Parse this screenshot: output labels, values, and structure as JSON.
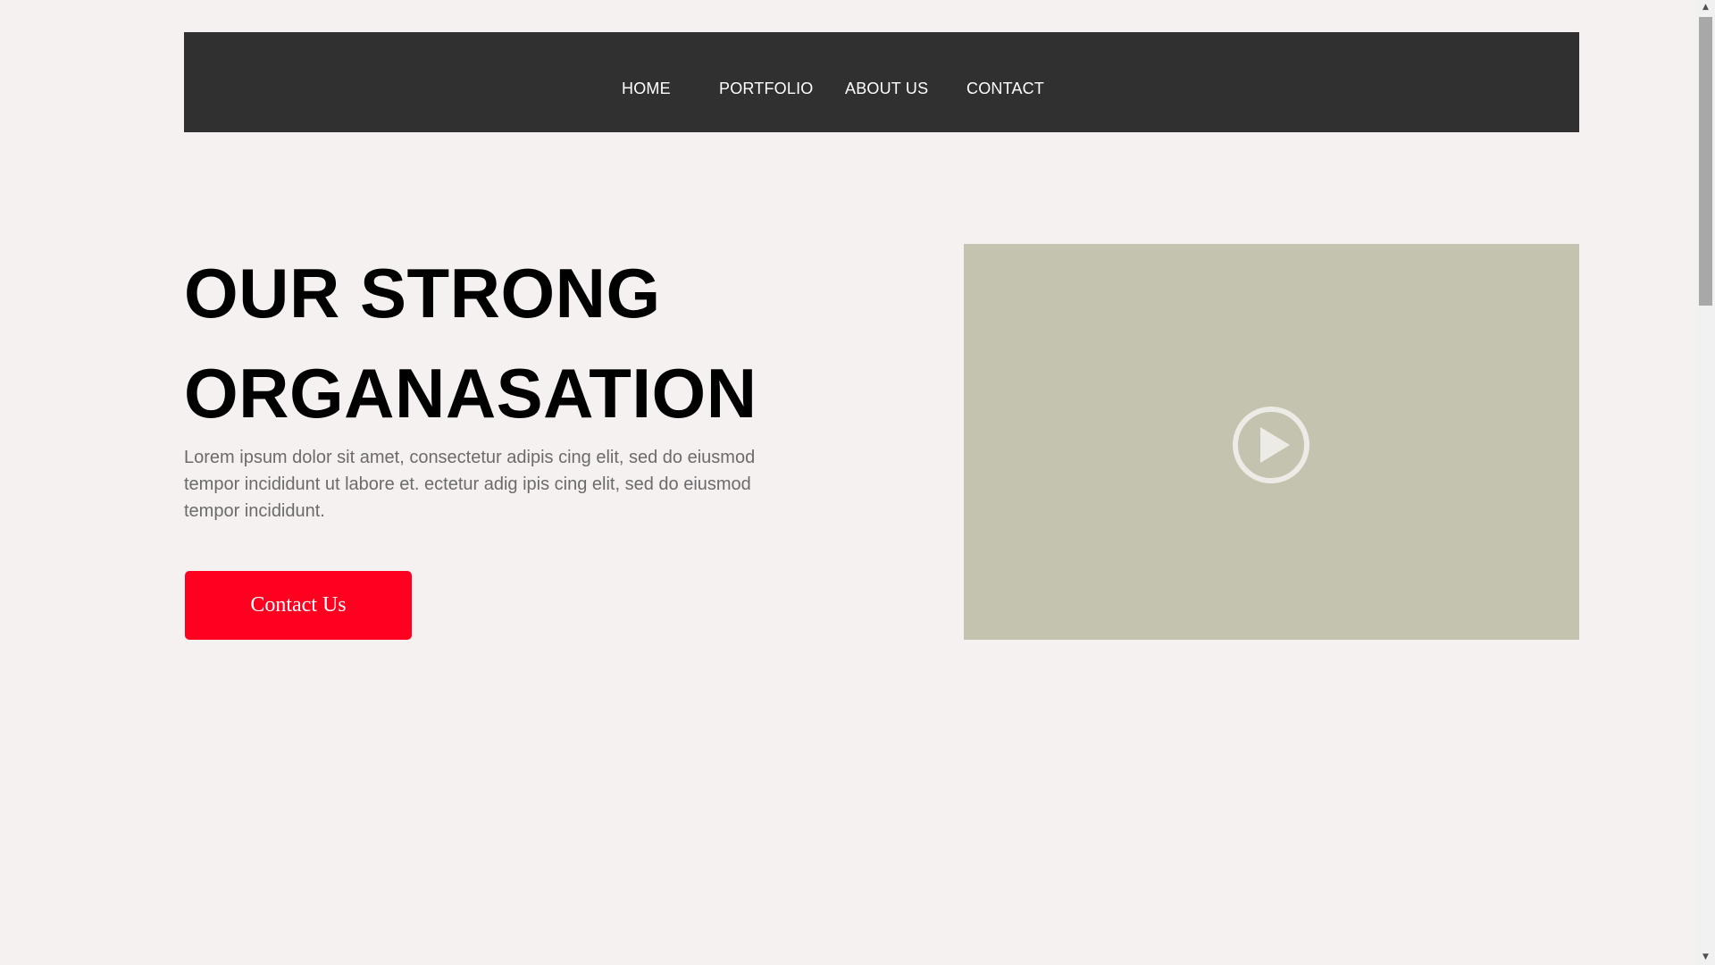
{
  "nav": {
    "items": [
      {
        "label": "HOME"
      },
      {
        "label": "PORTFOLIO"
      },
      {
        "label": "ABOUT US"
      },
      {
        "label": "CONTACT"
      }
    ]
  },
  "hero": {
    "title_line1": "OUR STRONG",
    "title_line2": "ORGANASATION",
    "description": "Lorem ipsum dolor sit amet, consectetur adipis cing elit, sed do eiusmod tempor incididunt ut labore et. ectetur adig ipis cing elit, sed do eiusmod tempor incididunt.",
    "cta_label": "Contact Us"
  },
  "video": {
    "icon": "play-circle-icon"
  },
  "colors": {
    "page_background": "#f5f1f0",
    "nav_background": "#303030",
    "cta_background": "#ff0020",
    "video_placeholder": "#c4c3b0",
    "description_text": "#6b6b6b"
  }
}
